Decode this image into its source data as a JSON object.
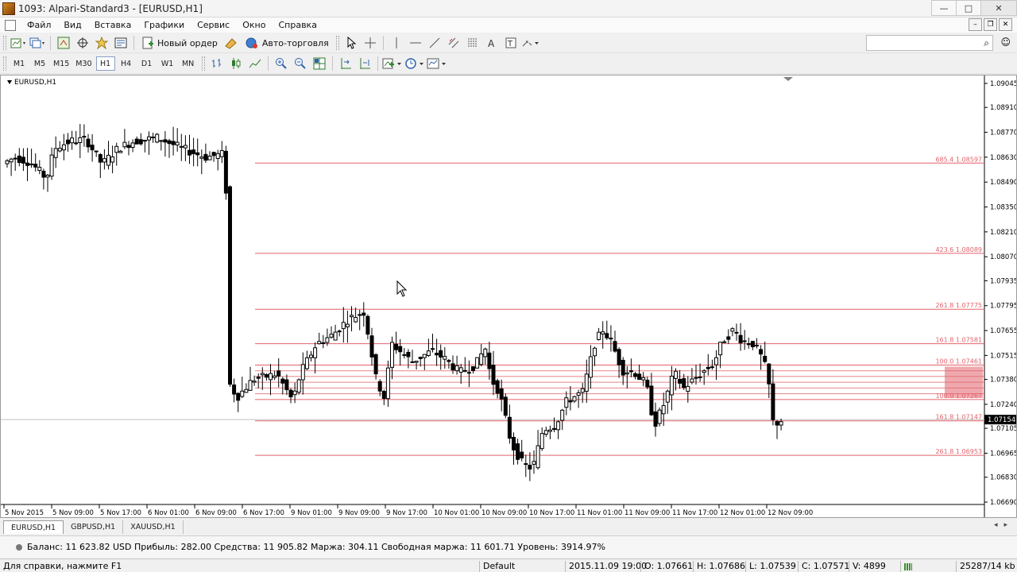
{
  "window": {
    "title": "1093: Alpari-Standard3 - [EURUSD,H1]",
    "minimize": "—",
    "maximize": "□",
    "close": "✕"
  },
  "menu": {
    "items": [
      "Файл",
      "Вид",
      "Вставка",
      "Графики",
      "Сервис",
      "Окно",
      "Справка"
    ]
  },
  "toolbar": {
    "new_order": "Новый ордер",
    "auto_trading": "Авто-торговля"
  },
  "timeframes": [
    "M1",
    "M5",
    "M15",
    "M30",
    "H1",
    "H4",
    "D1",
    "W1",
    "MN"
  ],
  "active_timeframe": "H1",
  "chart": {
    "title": "EURUSD,H1",
    "price_labels": [
      "1.09045",
      "1.08910",
      "1.08770",
      "1.08630",
      "1.08490",
      "1.08350",
      "1.08210",
      "1.08070",
      "1.07935",
      "1.07795",
      "1.07655",
      "1.07515",
      "1.07380",
      "1.07240",
      "1.07105",
      "1.06965",
      "1.06830",
      "1.06690"
    ],
    "current_price": "1.07154",
    "time_labels": [
      "5 Nov 2015",
      "5 Nov 09:00",
      "5 Nov 17:00",
      "6 Nov 01:00",
      "6 Nov 09:00",
      "6 Nov 17:00",
      "9 Nov 01:00",
      "9 Nov 09:00",
      "9 Nov 17:00",
      "10 Nov 01:00",
      "10 Nov 09:00",
      "10 Nov 17:00",
      "11 Nov 01:00",
      "11 Nov 09:00",
      "11 Nov 17:00",
      "12 Nov 01:00",
      "12 Nov 09:00"
    ],
    "fib_levels": [
      {
        "label": "685.4 1.08597",
        "price": 1.08597
      },
      {
        "label": "423.6 1.08089",
        "price": 1.08089
      },
      {
        "label": "261.8 1.07775",
        "price": 1.07775
      },
      {
        "label": "161.8 1.07581",
        "price": 1.07581
      },
      {
        "label": "100.0 1.07461",
        "price": 1.07461
      },
      {
        "label": "100.0 1.07267",
        "price": 1.07267
      },
      {
        "label": "161.8 1.07147",
        "price": 1.07147
      },
      {
        "label": "261.8 1.06953",
        "price": 1.06953
      }
    ],
    "fib_color": "#e2636b",
    "bull_color": "#ffffff",
    "bear_color": "#000000"
  },
  "tabs": [
    "EURUSD,H1",
    "GBPUSD,H1",
    "XAUUSD,H1"
  ],
  "active_tab": "EURUSD,H1",
  "balance": {
    "text": "Баланс: 11 623.82 USD  Прибыль: 282.00  Средства: 11 905.82  Маржа: 304.11  Свободная маржа: 11 601.71  Уровень: 3914.97%"
  },
  "status": {
    "help": "Для справки, нажмите F1",
    "profile": "Default",
    "datetime": "2015.11.09 19:00",
    "open": "O: 1.07661",
    "high": "H: 1.07686",
    "low": "L: 1.07539",
    "close": "C: 1.07571",
    "volume": "V: 4899",
    "traffic": "25287/14 kb"
  }
}
